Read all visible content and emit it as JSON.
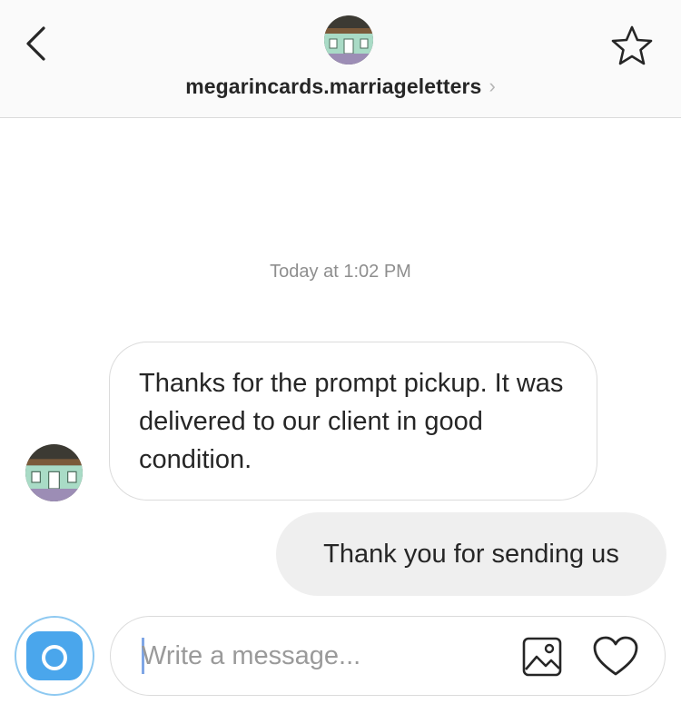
{
  "header": {
    "title": "megarincards.marriageletters",
    "chevron": "›",
    "back_icon": "chevron-left-icon",
    "star_icon": "star-outline-icon",
    "avatar_icon": "storefront-avatar"
  },
  "thread": {
    "timestamp": "Today at 1:02 PM",
    "messages": [
      {
        "direction": "incoming",
        "text": "Thanks for the prompt pickup. It was delivered to our client in good condition."
      },
      {
        "direction": "outgoing",
        "text": "Thank you for sending us"
      }
    ]
  },
  "composer": {
    "placeholder": "Write a message...",
    "value": "",
    "camera_icon": "camera-icon",
    "gallery_icon": "image-gallery-icon",
    "like_icon": "heart-outline-icon"
  },
  "colors": {
    "accent": "#4aa6ec",
    "header_bg": "#fafafa",
    "outgoing_bubble": "#efefef",
    "border": "#dbdbdb",
    "muted_text": "#8e8e8e"
  }
}
